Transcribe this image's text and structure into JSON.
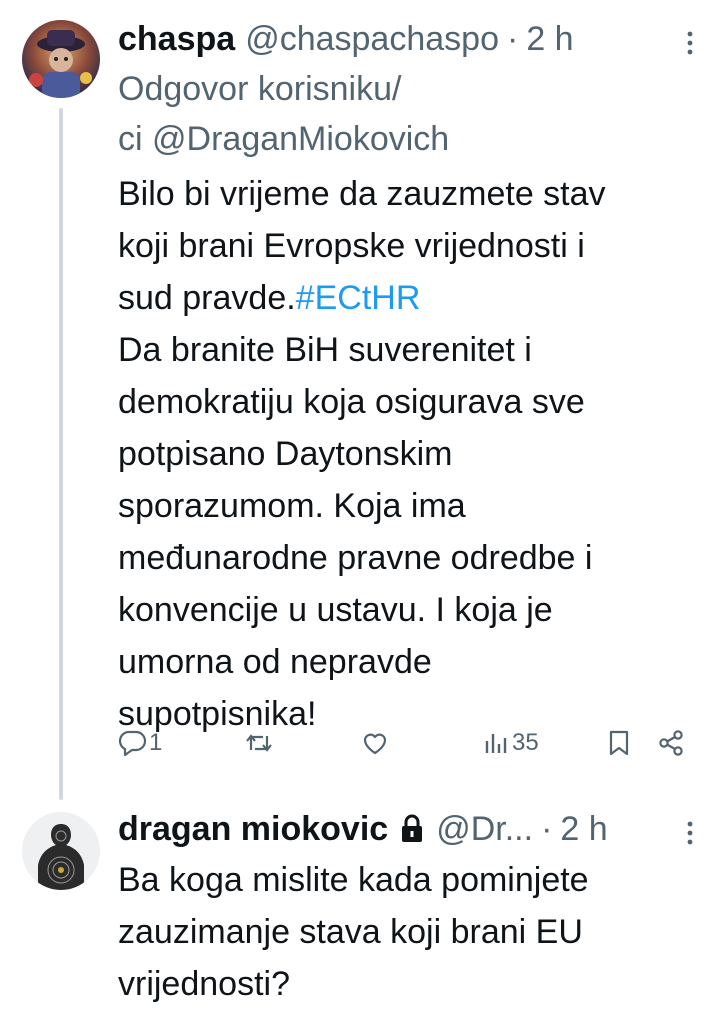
{
  "tweet1": {
    "display_name": "chaspa",
    "handle": "@chaspachaspo",
    "separator": "·",
    "time": "2 h",
    "reply_prefix": "Odgovor korisniku/",
    "reply_prefix2": "ci",
    "reply_mention": "@DraganMiokovich",
    "text_part1": "Bilo bi vrijeme da zauzmete stav\nkoji brani Evropske vrijednosti i\nsud pravde.",
    "hashtag": "#ECtHR",
    "text_part2": "\nDa branite BiH suverenitet i\ndemokratiju koja osigurava sve\npotpisano Daytonskim\nsporazumom. Koja ima\nmeđunarodne pravne odredbe i\nkonvencije u ustavu. I koja je\numorna od nepravde\nsupotpisnika!",
    "reply_count": "1",
    "retweet_count": "",
    "like_count": "",
    "view_count": "35",
    "icons": [
      "more-icon",
      "reply-icon",
      "retweet-icon",
      "like-icon",
      "views-icon",
      "bookmark-icon",
      "share-icon"
    ]
  },
  "tweet2": {
    "display_name": "dragan miokovic",
    "handle": "@Dr...",
    "separator": "·",
    "time": "2 h",
    "text": "Ba koga mislite kada pominjete\nzauzimanje stava koji brani EU\nvrijednosti?",
    "icons": [
      "lock-icon",
      "more-icon"
    ]
  },
  "colors": {
    "text": "#0f1419",
    "secondary": "#536471",
    "link": "#1d9bf0",
    "thread_line": "#cfd9de"
  }
}
